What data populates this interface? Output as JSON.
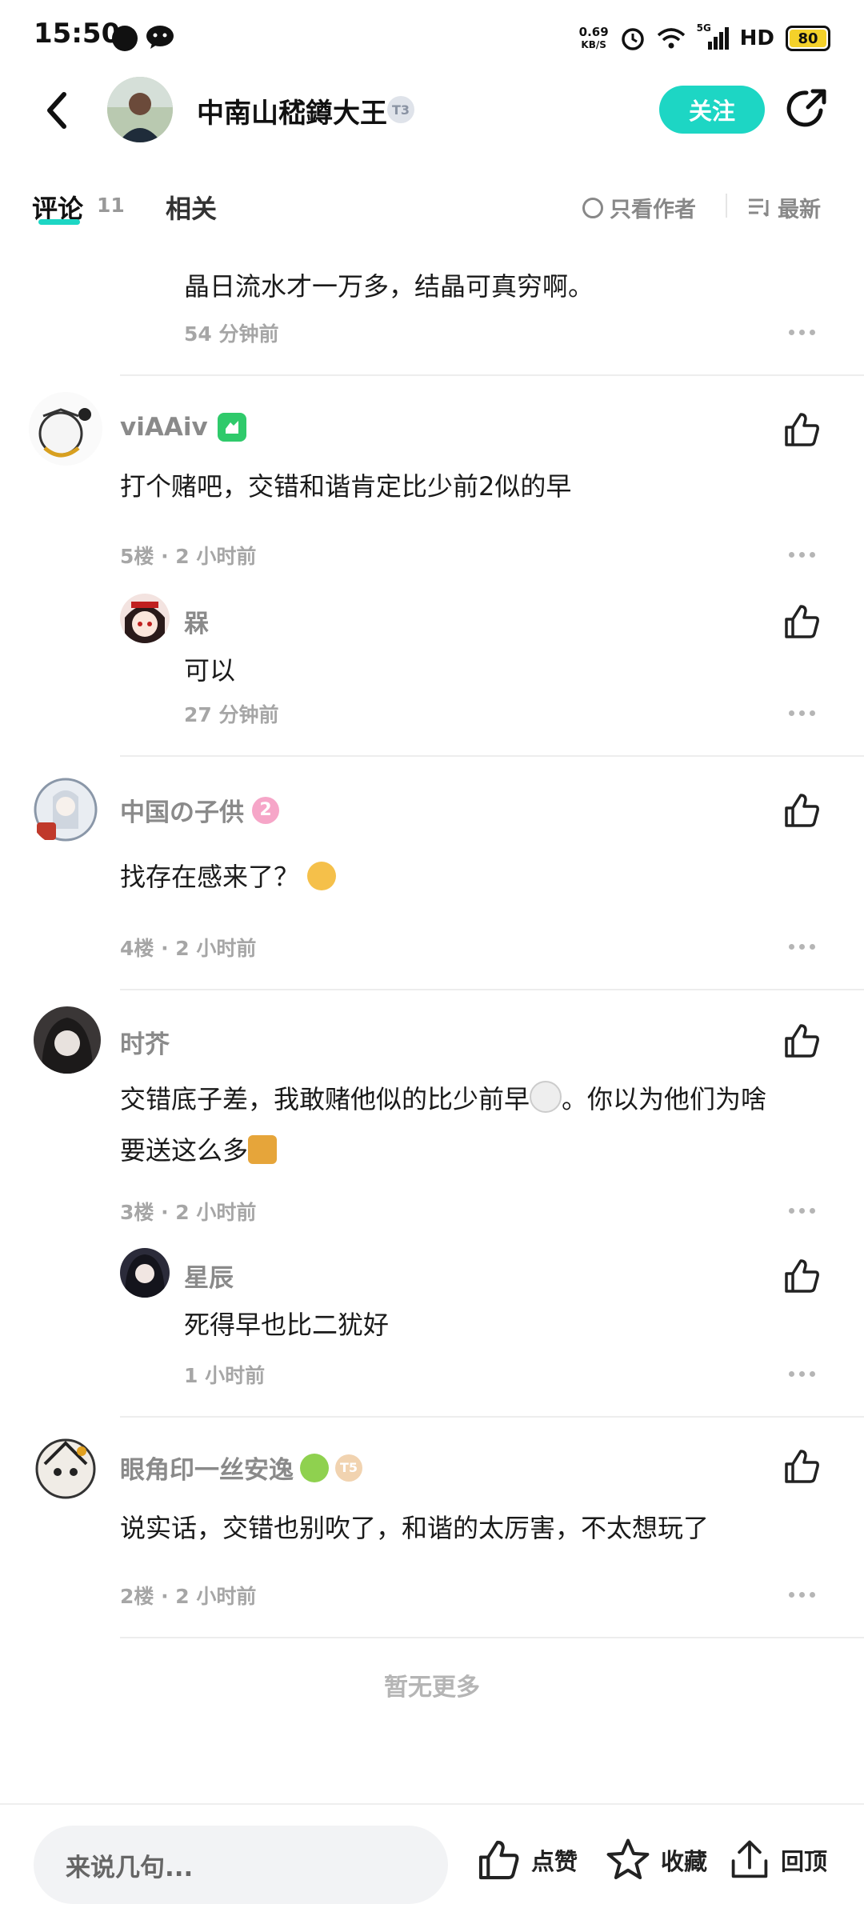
{
  "status_bar": {
    "time": "15:50",
    "net_speed_value": "0.69",
    "net_speed_unit": "KB/S",
    "signal_label": "5G",
    "hd_label": "HD",
    "battery": "80",
    "icons": [
      "app-notification-icon",
      "wechat-icon",
      "alarm-icon",
      "wifi-icon",
      "signal-icon"
    ]
  },
  "header": {
    "author_name": "中南山嵇鐏大王",
    "level_badge": "T3",
    "follow_label": "关注"
  },
  "tabs": {
    "comments_label": "评论",
    "comments_count": "11",
    "related_label": "相关",
    "only_author_label": "只看作者",
    "sort_label": "最新",
    "accent_color": "#1dd6c4"
  },
  "comments": {
    "partial_reply": {
      "text": "晶日流水才一万多，结晶可真穷啊。",
      "time": "54 分钟前"
    },
    "c5": {
      "user": "viAAiv",
      "text": "打个赌吧，交错和谐肯定比少前2似的早",
      "meta": "5楼 · 2 小时前",
      "reply": {
        "user": "槑",
        "text": "可以",
        "time": "27 分钟前"
      }
    },
    "c4": {
      "user": "中国の子供",
      "badge": "2",
      "text": "找存在感来了？",
      "meta": "4楼 · 2 小时前"
    },
    "c3": {
      "user": "时芥",
      "text_line1": "交错底子差，我敢赌他似的比少前早",
      "text_line1b": "。你以为他们为啥",
      "text_line2": "要送这么多",
      "meta": "3楼 · 2 小时前",
      "reply": {
        "user": "星辰",
        "text": "死得早也比二犹好",
        "time": "1 小时前"
      }
    },
    "c2": {
      "user": "眼角印一丝安逸",
      "level_badge": "T5",
      "text": "说实话，交错也别吹了，和谐的太厉害，不太想玩了",
      "meta": "2楼 · 2 小时前"
    }
  },
  "no_more": "暂无更多",
  "bottom_bar": {
    "input_placeholder": "来说几句...",
    "like_label": "点赞",
    "favorite_label": "收藏",
    "top_label": "回顶"
  }
}
